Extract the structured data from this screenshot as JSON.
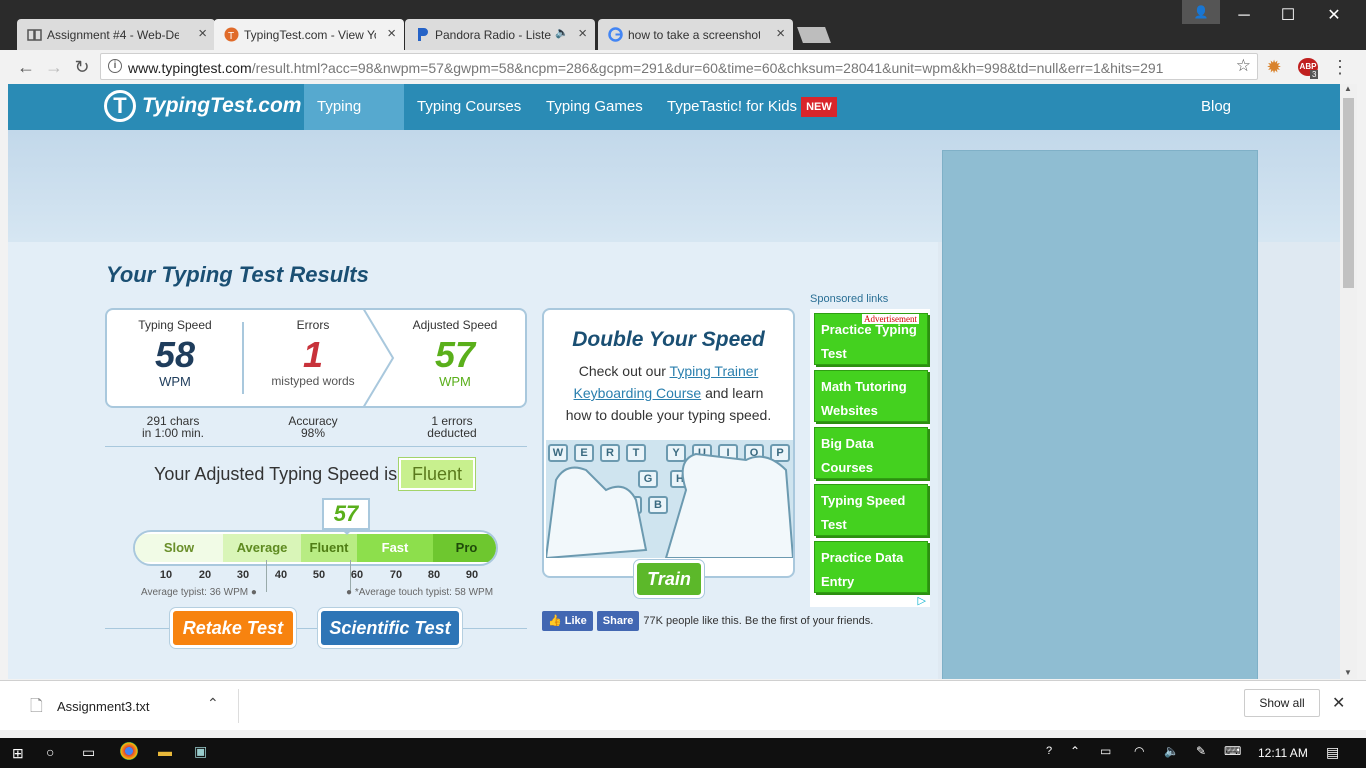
{
  "browser": {
    "tabs": [
      {
        "label": "Assignment #4 - Web-De",
        "icon": "book-icon"
      },
      {
        "label": "TypingTest.com - View Yo",
        "icon": "typingtest-favicon"
      },
      {
        "label": "Pandora Radio - Liste",
        "icon": "pandora-favicon"
      },
      {
        "label": "how to take a screenshot",
        "icon": "google-favicon"
      }
    ],
    "url_host": "www.typingtest.com",
    "url_path": "/result.html?acc=98&nwpm=57&gwpm=58&ncpm=286&gcpm=291&dur=60&time=60&chksum=28041&unit=wpm&kh=998&td=null&err=1&hits=291",
    "abp_count": "3"
  },
  "site": {
    "logo": "TypingTest.com",
    "nav": [
      "Typing Test",
      "Typing Courses",
      "Typing Games",
      "TypeTastic! for Kids"
    ],
    "new_badge": "NEW",
    "blog": "Blog"
  },
  "results": {
    "title": "Your Typing Test Results",
    "typing_speed_label": "Typing Speed",
    "typing_speed": "58",
    "typing_speed_unit": "WPM",
    "errors_label": "Errors",
    "errors": "1",
    "errors_unit": "mistyped words",
    "adjusted_label": "Adjusted Speed",
    "adjusted": "57",
    "adjusted_unit": "WPM",
    "sub1a": "291 chars",
    "sub1b": "in 1:00 min.",
    "sub2a": "Accuracy",
    "sub2b": "98%",
    "sub3a": "1 errors",
    "sub3b": "deducted",
    "adjusted_line": "Your Adjusted Typing Speed is",
    "level": "Fluent",
    "marker": "57",
    "scale": [
      "Slow",
      "Average",
      "Fluent",
      "Fast",
      "Pro"
    ],
    "ticks": [
      "10",
      "20",
      "30",
      "40",
      "50",
      "60",
      "70",
      "80",
      "90"
    ],
    "avg_typist": "Average typist: 36 WPM",
    "avg_touch": "*Average touch typist: 58 WPM",
    "retake": "Retake Test",
    "scientific": "Scientific Test"
  },
  "promo": {
    "title": "Double Your Speed",
    "text1": "Check out our",
    "link1": "Typing Trainer",
    "link2": "Keyboarding Course",
    "text2": "and learn",
    "text3": "how to double your typing speed.",
    "train": "Train",
    "keys_row1": [
      "W",
      "E",
      "R",
      "T",
      "Y",
      "U",
      "I",
      "O",
      "P"
    ],
    "keys_row2": [
      "G",
      "H"
    ],
    "keys_row3": [
      "V",
      "B"
    ]
  },
  "social": {
    "like": "Like",
    "share": "Share",
    "text": "77K people like this. Be the first of your friends."
  },
  "ads": {
    "sponsored": "Sponsored links",
    "label": "Advertisement",
    "links": [
      "Practice Typing Test",
      "Math Tutoring Websites",
      "Big Data Courses",
      "Typing Speed Test",
      "Practice Data Entry"
    ]
  },
  "download": {
    "file": "Assignment3.txt",
    "show_all": "Show all"
  },
  "taskbar": {
    "time": "12:11 AM"
  }
}
